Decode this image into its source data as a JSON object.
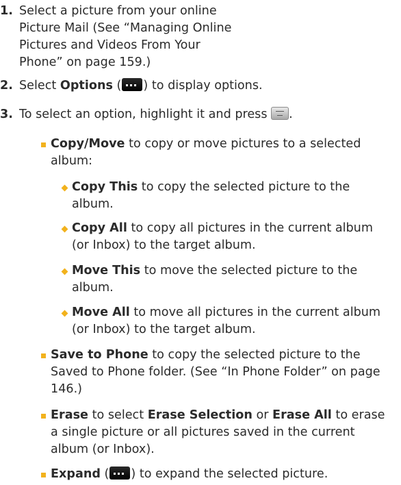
{
  "steps": [
    {
      "num": "1.",
      "text": "Select a picture from your online Picture Mail (See “Managing Online Pictures and Videos From Your Phone” on page 159.)"
    },
    {
      "num": "2.",
      "pre": "Select ",
      "bold": "Options",
      "post_open": " (",
      "post_close": ") to display options.",
      "icon": "options-softkey-icon"
    },
    {
      "num": "3.",
      "pre": "To select an option, highlight it and press ",
      "post": ".",
      "icon": "menu-ok-key-icon"
    }
  ],
  "options": [
    {
      "bold": "Copy/Move",
      "text": " to copy or move pictures to a selected album:",
      "sub": [
        {
          "bold": "Copy This",
          "text": " to copy the selected picture to the album."
        },
        {
          "bold": "Copy All",
          "text": " to copy all pictures in the current album (or Inbox) to the target album."
        },
        {
          "bold": "Move This",
          "text": " to move the selected picture to the album."
        },
        {
          "bold": "Move All",
          "text": " to move all pictures in the current album (or Inbox) to the target album."
        }
      ]
    },
    {
      "bold": "Save to Phone",
      "text": " to copy the selected picture to the Saved to Phone folder. (See “In Phone Folder” on page 146.)"
    },
    {
      "bold": "Erase",
      "text_a": " to select ",
      "bold_b": "Erase Selection",
      "text_b": " or ",
      "bold_c": "Erase All",
      "text_c": " to erase a single picture or all pictures saved in the current album (or Inbox)."
    },
    {
      "bold": "Expand",
      "pre_icon": " (",
      "post_icon": ") to expand the selected picture.",
      "icon": "options-softkey-icon"
    }
  ],
  "colors": {
    "bullet": "#f2b21d",
    "text": "#2b2b2b"
  }
}
